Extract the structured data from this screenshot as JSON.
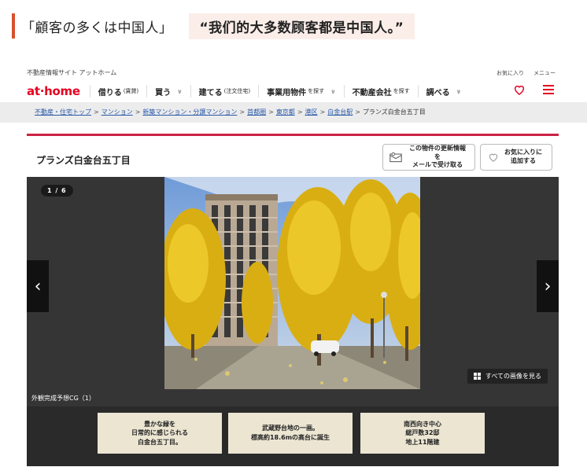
{
  "article": {
    "jp_caption": "「顧客の多くは中国人」",
    "cn_caption": "“我们的大多数顾客都是中国人。”"
  },
  "site": {
    "tagline": "不動産情報サイト アットホーム",
    "logo_main": "at",
    "logo_dot": "·",
    "logo_end": "home",
    "util_favorites": "お気に入り",
    "util_menu": "メニュー",
    "accent_color": "#e60021"
  },
  "nav": [
    {
      "label": "借りる",
      "sub": "(賃貸)",
      "chev": ""
    },
    {
      "label": "買う",
      "sub": "",
      "chev": "∨"
    },
    {
      "label": "建てる",
      "sub": "(注文住宅)",
      "chev": ""
    },
    {
      "label": "事業用物件",
      "sub": "を探す",
      "chev": "∨"
    },
    {
      "label": "不動産会社",
      "sub": "を探す",
      "chev": ""
    },
    {
      "label": "調べる",
      "sub": "",
      "chev": "∨"
    }
  ],
  "breadcrumb": [
    "不動産・住宅トップ",
    "マンション",
    "新築マンション・分譲マンション",
    "首都圏",
    "東京都",
    "港区",
    "白金台駅"
  ],
  "breadcrumb_current": "プランズ白金台五丁目",
  "breadcrumb_sep": ">",
  "property": {
    "title": "プランズ白金台五丁目",
    "mail_button_line1": "この物件の更新情報を",
    "mail_button_line2": "メールで受け取る",
    "fav_button_line1": "お気に入りに",
    "fav_button_line2": "追加する",
    "counter": "1 / 6",
    "all_images": "すべての画像を見る",
    "caption": "外観完成予想CG（1）",
    "prev_arrow": "‹",
    "next_arrow": "›"
  },
  "features": [
    {
      "line1": "豊かな緑を",
      "line2": "日常的に感じられる",
      "line3": "白金台五丁目。"
    },
    {
      "line1": "武蔵野台地の一画。",
      "line2": "標高約18.6mの高台に誕生",
      "line3": ""
    },
    {
      "line1": "南西向き中心",
      "line2": "総戸数32邸",
      "line3": "地上11階建"
    }
  ]
}
